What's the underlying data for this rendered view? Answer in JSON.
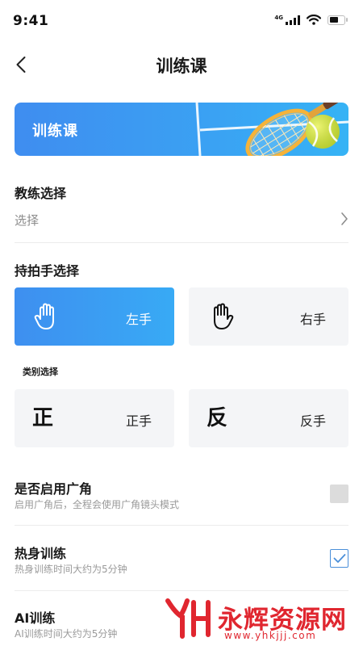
{
  "status_bar": {
    "time": "9:41",
    "network_tag": "4G"
  },
  "nav": {
    "title": "训练课"
  },
  "banner": {
    "title": "训练课"
  },
  "coach": {
    "label": "教练选择",
    "value": "选择"
  },
  "grip": {
    "label": "持拍手选择",
    "options": [
      {
        "label": "左手",
        "selected": true
      },
      {
        "label": "右手",
        "selected": false
      }
    ]
  },
  "category": {
    "label": "类别选择",
    "options": [
      {
        "glyph": "正",
        "label": "正手"
      },
      {
        "glyph": "反",
        "label": "反手"
      }
    ]
  },
  "settings": [
    {
      "title": "是否启用广角",
      "desc": "启用广角后，全程会使用广角镜头模式",
      "checked": false
    },
    {
      "title": "热身训练",
      "desc": "热身训练时间大约为5分钟",
      "checked": true
    },
    {
      "title": "AI训练",
      "desc": "AI训练时间大约为5分钟"
    }
  ],
  "watermark": {
    "name": "永辉资源网",
    "url": "www.yhkjjj.com"
  },
  "colors": {
    "accent": "#3e8ff0",
    "accent_light": "#38aaf5",
    "card_bg": "#f4f5f7",
    "watermark": "#e0262f"
  }
}
